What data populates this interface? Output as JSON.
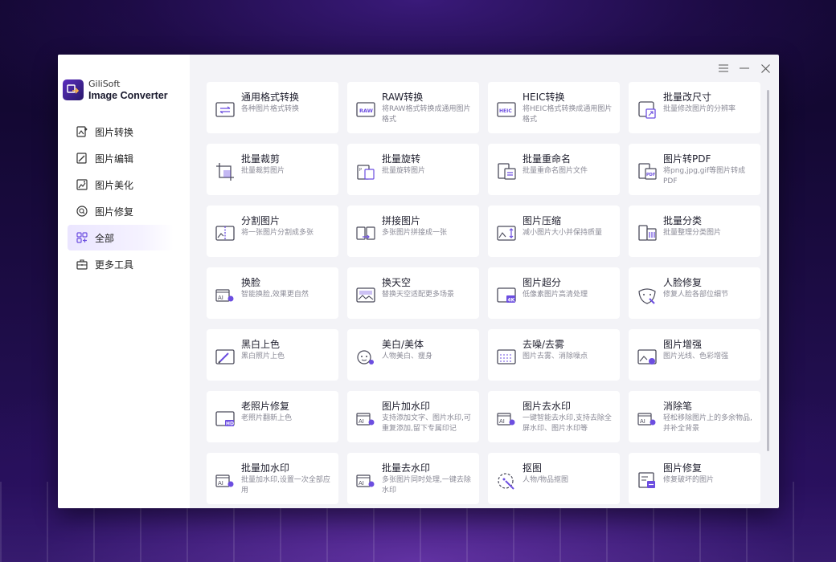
{
  "app": {
    "brand": "GiliSoft",
    "name": "Image Converter"
  },
  "sidebar": {
    "items": [
      {
        "label": "图片转换",
        "icon": "image-convert-icon"
      },
      {
        "label": "图片编辑",
        "icon": "image-edit-icon"
      },
      {
        "label": "图片美化",
        "icon": "image-beautify-icon"
      },
      {
        "label": "图片修复",
        "icon": "image-repair-icon"
      },
      {
        "label": "全部",
        "icon": "grid-icon",
        "active": true
      },
      {
        "label": "更多工具",
        "icon": "toolbox-icon"
      }
    ]
  },
  "cards": [
    {
      "title": "通用格式转换",
      "desc": "各种图片格式转换",
      "icon": "format-convert-icon"
    },
    {
      "title": "RAW转换",
      "desc": "将RAW格式转换成通用图片格式",
      "icon": "raw-icon"
    },
    {
      "title": "HEIC转换",
      "desc": "将HEIC格式转换成通用图片格式",
      "icon": "heic-icon"
    },
    {
      "title": "批量改尺寸",
      "desc": "批量修改图片的分辨率",
      "icon": "resize-icon"
    },
    {
      "title": "批量裁剪",
      "desc": "批量裁剪图片",
      "icon": "crop-icon"
    },
    {
      "title": "批量旋转",
      "desc": "批量旋转图片",
      "icon": "rotate-icon"
    },
    {
      "title": "批量重命名",
      "desc": "批量重命名图片文件",
      "icon": "rename-icon"
    },
    {
      "title": "图片转PDF",
      "desc": "将png,jpg,gif等图片转成PDF",
      "icon": "pdf-icon"
    },
    {
      "title": "分割图片",
      "desc": "将一张图片分割成多张",
      "icon": "split-icon"
    },
    {
      "title": "拼接图片",
      "desc": "多张图片拼接成一张",
      "icon": "merge-icon"
    },
    {
      "title": "图片压缩",
      "desc": "减小图片大小并保持质量",
      "icon": "compress-icon"
    },
    {
      "title": "批量分类",
      "desc": "批量整理分类图片",
      "icon": "classify-icon"
    },
    {
      "title": "换脸",
      "desc": "智能换脸,效果更自然",
      "icon": "ai-faceswap-icon"
    },
    {
      "title": "换天空",
      "desc": "替换天空适配更多场景",
      "icon": "sky-replace-icon"
    },
    {
      "title": "图片超分",
      "desc": "低像素图片高清处理",
      "icon": "upscale-4k-icon"
    },
    {
      "title": "人脸修复",
      "desc": "修复人脸各部位细节",
      "icon": "face-repair-icon"
    },
    {
      "title": "黑白上色",
      "desc": "黑白照片上色",
      "icon": "colorize-icon"
    },
    {
      "title": "美白/美体",
      "desc": "人物美白、瘦身",
      "icon": "beautify-face-icon"
    },
    {
      "title": "去噪/去雾",
      "desc": "图片去雾、消除噪点",
      "icon": "denoise-icon"
    },
    {
      "title": "图片增强",
      "desc": "图片光线、色彩增强",
      "icon": "enhance-icon"
    },
    {
      "title": "老照片修复",
      "desc": "老照片翻新上色",
      "icon": "old-photo-hd-icon"
    },
    {
      "title": "图片加水印",
      "desc": "支持添加文字、图片水印,可重复添加,留下专属印记",
      "icon": "ai-watermark-add-icon"
    },
    {
      "title": "图片去水印",
      "desc": "一键智能去水印,支持去除全屏水印、图片水印等",
      "icon": "ai-watermark-remove-icon"
    },
    {
      "title": "消除笔",
      "desc": "轻松移除图片上的多余物品,并补全背景",
      "icon": "ai-eraser-icon"
    },
    {
      "title": "批量加水印",
      "desc": "批量加水印,设置一次全部应用",
      "icon": "ai-batch-watermark-add-icon"
    },
    {
      "title": "批量去水印",
      "desc": "多张图片同时处理,一键去除水印",
      "icon": "ai-batch-watermark-remove-icon"
    },
    {
      "title": "抠图",
      "desc": "人物/物品抠图",
      "icon": "cutout-icon"
    },
    {
      "title": "图片修复",
      "desc": "修复破坏的图片",
      "icon": "photo-repair-icon"
    }
  ],
  "colors": {
    "accent": "#6c4ee0",
    "sidebar_active": "#ebe6ff"
  }
}
